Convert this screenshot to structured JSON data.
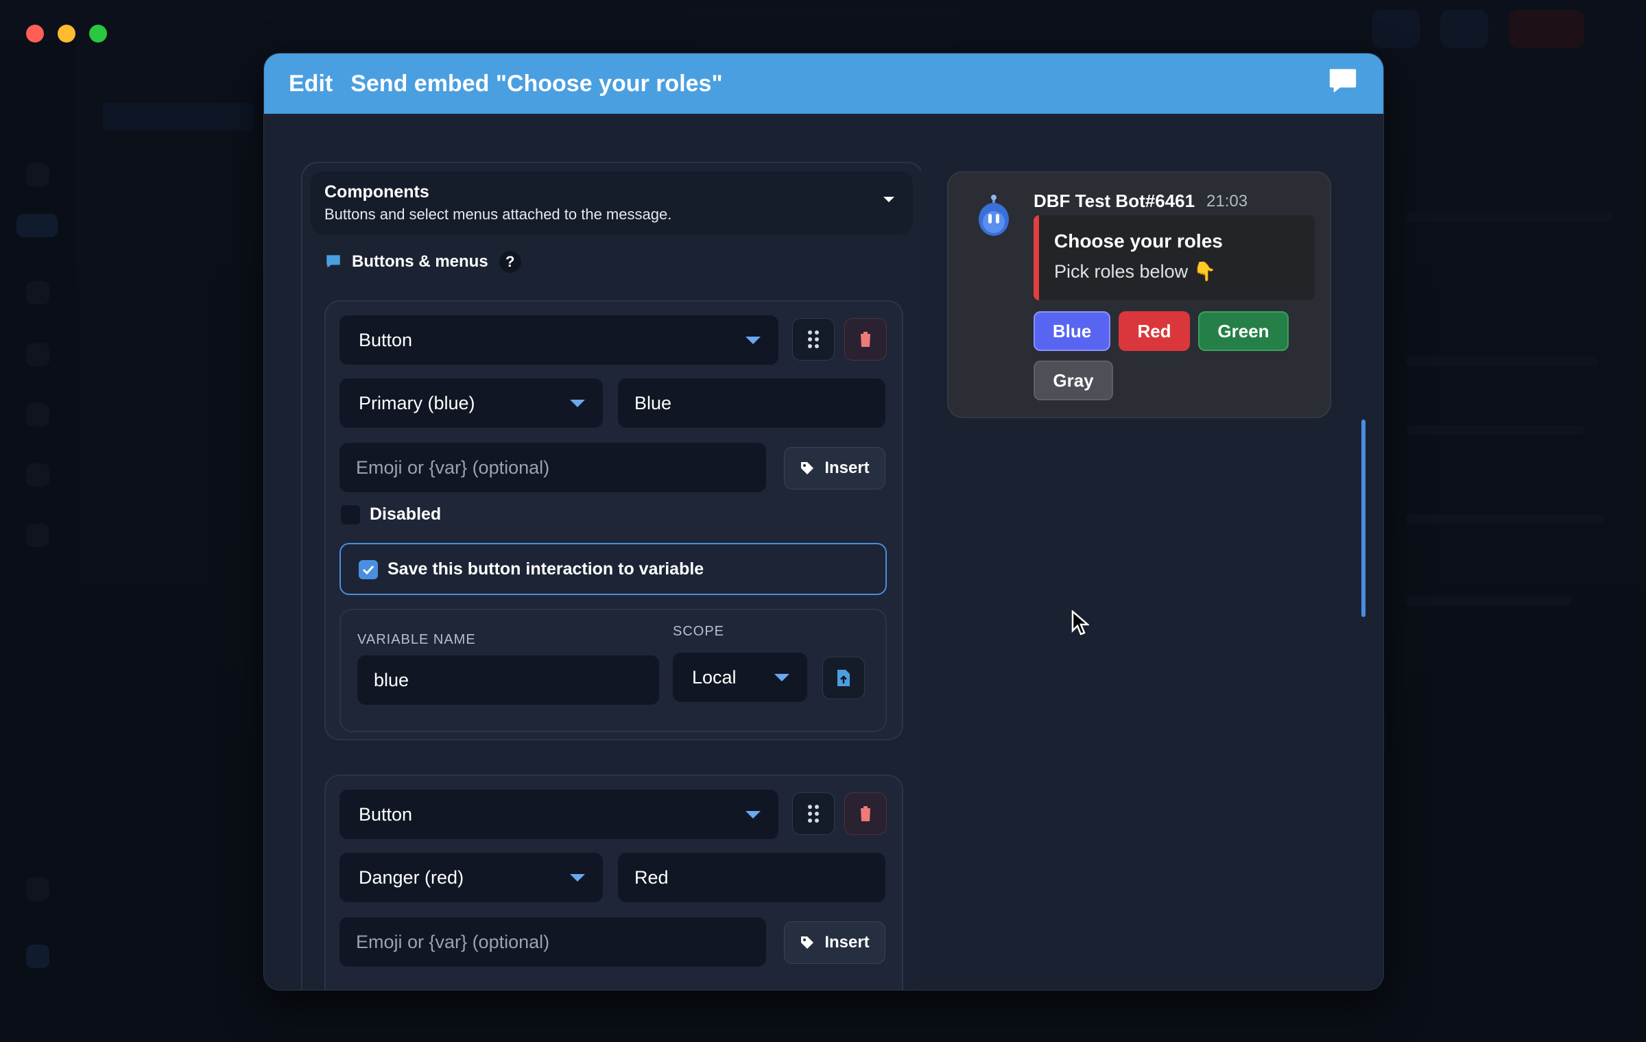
{
  "modal": {
    "header_prefix": "Edit",
    "header_title": "Send embed \"Choose your roles\""
  },
  "components": {
    "title": "Components",
    "subtitle": "Buttons and select menus attached to the message.",
    "section_label": "Buttons & menus",
    "help_label": "?"
  },
  "cards": [
    {
      "type": "Button",
      "style": "Primary (blue)",
      "label": "Blue",
      "emoji_placeholder": "Emoji or {var} (optional)",
      "insert_label": "Insert",
      "disabled_label": "Disabled",
      "save_label": "Save this button interaction to variable",
      "variable_name_label": "VARIABLE NAME",
      "variable_name": "blue",
      "scope_label": "SCOPE",
      "scope": "Local"
    },
    {
      "type": "Button",
      "style": "Danger (red)",
      "label": "Red",
      "emoji_placeholder": "Emoji or {var} (optional)",
      "insert_label": "Insert"
    }
  ],
  "preview": {
    "bot_name": "DBF Test Bot#6461",
    "time": "21:03",
    "embed_title": "Choose your roles",
    "embed_desc": "Pick roles below 👇",
    "embed_color": "#e04040",
    "buttons": [
      {
        "label": "Blue",
        "color": "#5865f2"
      },
      {
        "label": "Red",
        "color": "#da373c"
      },
      {
        "label": "Green",
        "color": "#248046"
      },
      {
        "label": "Gray",
        "color": "#4e5058"
      }
    ]
  },
  "colors": {
    "header": "#4a9fe0",
    "accent": "#4a8ee0"
  }
}
